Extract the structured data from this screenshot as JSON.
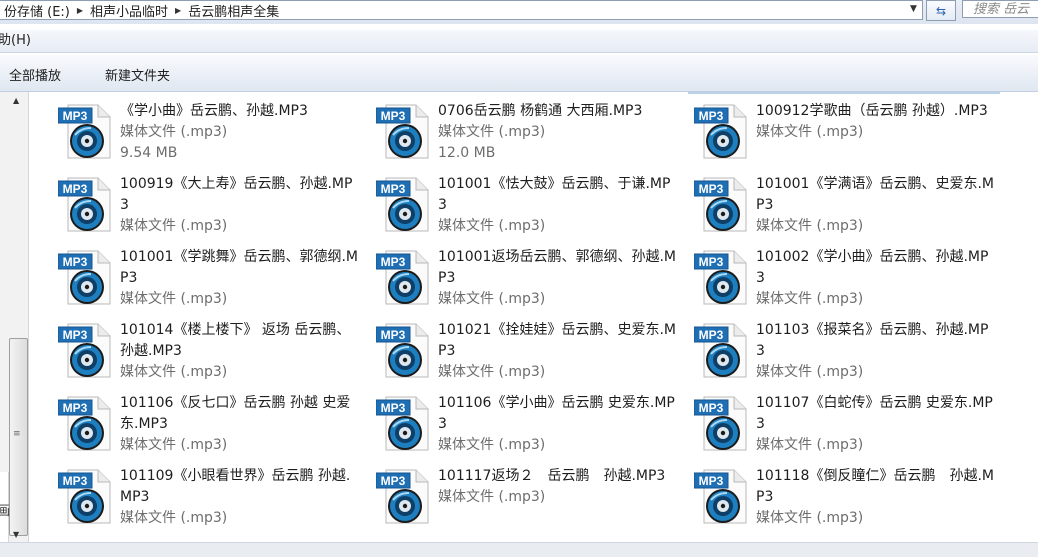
{
  "address_bar": {
    "crumbs": [
      "份存储 (E:)",
      "相声小品临时",
      "岳云鹏相声全集"
    ],
    "search_placeholder": "搜索 岳云"
  },
  "menu": {
    "partial_item": "助(H)"
  },
  "command_bar": {
    "play_all": "全部播放",
    "new_folder": "新建文件夹"
  },
  "left_pane": {
    "fragment": "画"
  },
  "icon": {
    "badge": "MP3"
  },
  "files": [
    {
      "name": "《学小曲》岳云鹏、孙越.MP3",
      "type": "媒体文件 (.mp3)",
      "size": "9.54 MB"
    },
    {
      "name": "0706岳云鹏 杨鹤通 大西厢.MP3",
      "type": "媒体文件 (.mp3)",
      "size": "12.0 MB"
    },
    {
      "name": "100912学歌曲（岳云鹏 孙越）.MP3",
      "type": "媒体文件 (.mp3)",
      "size": ""
    },
    {
      "name": "100919《大上寿》岳云鹏、孙越.MP3",
      "type": "媒体文件 (.mp3)",
      "size": ""
    },
    {
      "name": "101001《怯大鼓》岳云鹏、于谦.MP3",
      "type": "媒体文件 (.mp3)",
      "size": ""
    },
    {
      "name": "101001《学满语》岳云鹏、史爱东.MP3",
      "type": "媒体文件 (.mp3)",
      "size": ""
    },
    {
      "name": "101001《学跳舞》岳云鹏、郭德纲.MP3",
      "type": "媒体文件 (.mp3)",
      "size": ""
    },
    {
      "name": "101001返场岳云鹏、郭德纲、孙越.MP3",
      "type": "媒体文件 (.mp3)",
      "size": ""
    },
    {
      "name": "101002《学小曲》岳云鹏、孙越.MP3",
      "type": "媒体文件 (.mp3)",
      "size": ""
    },
    {
      "name": "101014《楼上楼下》 返场 岳云鹏、孙越.MP3",
      "type": "媒体文件 (.mp3)",
      "size": ""
    },
    {
      "name": "101021《拴娃娃》岳云鹏、史爱东.MP3",
      "type": "媒体文件 (.mp3)",
      "size": ""
    },
    {
      "name": "101103《报菜名》岳云鹏、孙越.MP3",
      "type": "媒体文件 (.mp3)",
      "size": ""
    },
    {
      "name": "101106《反七口》岳云鹏 孙越 史爱东.MP3",
      "type": "媒体文件 (.mp3)",
      "size": ""
    },
    {
      "name": "101106《学小曲》岳云鹏 史爱东.MP3",
      "type": "媒体文件 (.mp3)",
      "size": ""
    },
    {
      "name": "101107《白蛇传》岳云鹏 史爱东.MP3",
      "type": "媒体文件 (.mp3)",
      "size": ""
    },
    {
      "name": "101109《小眼看世界》岳云鹏 孙越.MP3",
      "type": "媒体文件 (.mp3)",
      "size": ""
    },
    {
      "name": "101117返场２　岳云鹏　孙越.MP3",
      "type": "媒体文件 (.mp3)",
      "size": ""
    },
    {
      "name": "101118《倒反瞳仁》岳云鹏　孙越.MP3",
      "type": "媒体文件 (.mp3)",
      "size": ""
    }
  ]
}
